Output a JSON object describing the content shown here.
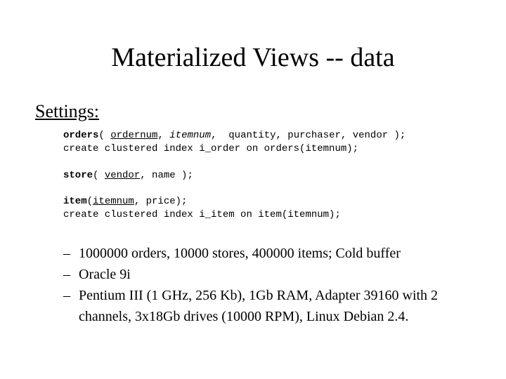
{
  "title": "Materialized Views -- data",
  "settings_label": "Settings:",
  "code": {
    "orders_kw": "orders",
    "orders_open": "( ",
    "ordernum": "ordernum",
    "orders_sep1": ", ",
    "itemnum_i": "itemnum",
    "orders_rest": ",  quantity, purchaser, vendor );",
    "orders_idx": "create clustered index i_order on orders(itemnum);",
    "store_kw": "store",
    "store_open": "( ",
    "vendor_u": "vendor",
    "store_rest": ", name );",
    "item_kw": "item",
    "item_open": "(",
    "itemnum_u": "itemnum",
    "item_rest": ", price);",
    "item_idx": "create clustered index i_item on item(itemnum);"
  },
  "bullets": [
    "1000000 orders, 10000 stores, 400000 items; Cold buffer",
    "Oracle 9i",
    "Pentium III (1 GHz, 256 Kb), 1Gb RAM, Adapter 39160 with 2 channels, 3x18Gb drives (10000 RPM), Linux Debian 2.4."
  ],
  "dash": "–"
}
